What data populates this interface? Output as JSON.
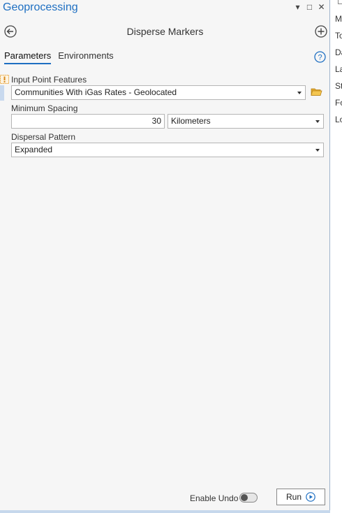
{
  "pane": {
    "title": "Geoprocessing",
    "controls": [
      "▾",
      "□",
      "✕"
    ]
  },
  "tool": {
    "title": "Disperse Markers"
  },
  "tabs": [
    {
      "label": "Parameters",
      "active": true
    },
    {
      "label": "Environments",
      "active": false
    }
  ],
  "params": {
    "input_label": "Input Point Features",
    "input_value": "Communities With iGas Rates - Geolocated",
    "spacing_label": "Minimum Spacing",
    "spacing_value": "30",
    "spacing_unit": "Kilometers",
    "pattern_label": "Dispersal Pattern",
    "pattern_value": "Expanded"
  },
  "footer": {
    "undo_label": "Enable Undo",
    "undo_enabled": false,
    "run_label": "Run"
  },
  "side_list": [
    "M",
    "To",
    "Da",
    "La",
    "St",
    "Fo",
    "Lo"
  ],
  "colors": {
    "accent": "#1e6fc2",
    "pane_bg": "#f6f6f6",
    "warning": "#e8a33a"
  }
}
